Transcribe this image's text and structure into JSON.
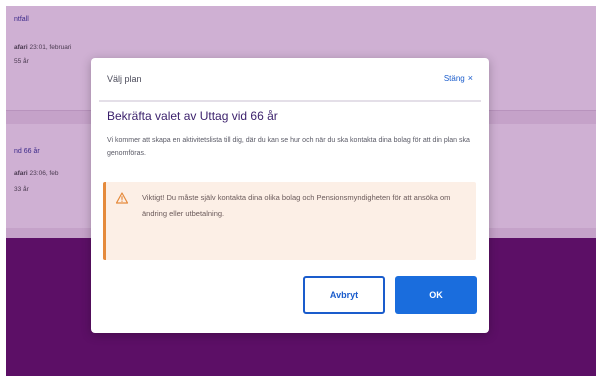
{
  "background": {
    "cards": [
      {
        "link": "ntfall",
        "meta_prefix": "",
        "meta_label": "afari",
        "meta_value": "23:01, februari",
        "sub": "55 år"
      },
      {
        "link": "nd 66 år",
        "meta_prefix": "",
        "meta_label": "afari",
        "meta_value": "23:06, feb",
        "sub": "33 år"
      }
    ]
  },
  "modal": {
    "title": "Välj plan",
    "close_label": "Stäng",
    "close_icon": "×",
    "heading": "Bekräfta valet av Uttag vid 66 år",
    "body": "Vi kommer att skapa en aktivitetslista till dig, där du kan se hur och när du ska kontakta dina bolag för att din plan ska genomföras.",
    "warning": "Viktigt! Du måste själv kontakta dina olika bolag och Pensionsmyndigheten för att ansöka om ändring eller utbetalning.",
    "cancel_label": "Avbryt",
    "ok_label": "OK"
  },
  "colors": {
    "overlay": "#c5a2c9",
    "page_bottom": "#5c0f66",
    "accent": "#1a6ddd",
    "warning_border": "#e58a3c",
    "warning_bg": "#fcefe6"
  }
}
